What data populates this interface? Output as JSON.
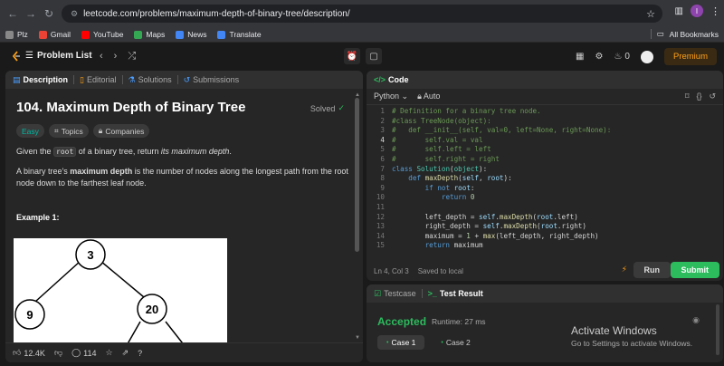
{
  "browser": {
    "url": "leetcode.com/problems/maximum-depth-of-binary-tree/description/",
    "profile_initial": "I",
    "bookmarks": [
      {
        "label": "Plz",
        "color": "#888888"
      },
      {
        "label": "Gmail",
        "color": "#ea4335"
      },
      {
        "label": "YouTube",
        "color": "#ff0000"
      },
      {
        "label": "Maps",
        "color": "#34a853"
      },
      {
        "label": "News",
        "color": "#4285f4"
      },
      {
        "label": "Translate",
        "color": "#4285f4"
      }
    ],
    "all_bookmarks": "All Bookmarks"
  },
  "lc": {
    "problem_list": "Problem List",
    "streak": "0",
    "premium": "Premium"
  },
  "left_tabs": [
    "Description",
    "Editorial",
    "Solutions",
    "Submissions"
  ],
  "problem": {
    "title": "104. Maximum Depth of Binary Tree",
    "solved": "Solved",
    "difficulty": "Easy",
    "topics": "Topics",
    "companies": "Companies",
    "p1_a": "Given the ",
    "p1_code": "root",
    "p1_b": " of a binary tree, return ",
    "p1_em": "its maximum depth",
    "p1_c": ".",
    "p2_a": "A binary tree's ",
    "p2_b": "maximum depth",
    "p2_c": " is the number of nodes along the longest path from the root node down to the farthest leaf node.",
    "example": "Example 1:",
    "tree_nodes": [
      "3",
      "9",
      "20"
    ]
  },
  "bottom_bar": {
    "likes": "12.4K",
    "comments": "114"
  },
  "code_panel": {
    "tab": "Code",
    "language": "Python",
    "mode": "Auto",
    "status_pos": "Ln 4, Col 3",
    "status_saved": "Saved to local",
    "run": "Run",
    "submit": "Submit"
  },
  "code_lines": [
    {
      "n": "1",
      "text": "# Definition for a binary tree node."
    },
    {
      "n": "2",
      "text": "#class TreeNode(object):"
    },
    {
      "n": "3",
      "text": "#   def __init__(self, val=0, left=None, right=None):"
    },
    {
      "n": "4",
      "text": "#       self.val = val"
    },
    {
      "n": "5",
      "text": "#       self.left = left"
    },
    {
      "n": "6",
      "text": "#       self.right = right"
    },
    {
      "n": "7",
      "text": "class Solution(object):"
    },
    {
      "n": "8",
      "text": "    def maxDepth(self, root):"
    },
    {
      "n": "9",
      "text": "        if not root:"
    },
    {
      "n": "10",
      "text": "            return 0"
    },
    {
      "n": "11",
      "text": ""
    },
    {
      "n": "12",
      "text": "        left_depth = self.maxDepth(root.left)"
    },
    {
      "n": "13",
      "text": "        right_depth = self.maxDepth(root.right)"
    },
    {
      "n": "14",
      "text": "        maximum = 1 + max(left_depth, right_depth)"
    },
    {
      "n": "15",
      "text": "        return maximum"
    }
  ],
  "result": {
    "tab_testcase": "Testcase",
    "tab_result": "Test Result",
    "accepted": "Accepted",
    "runtime": "Runtime: 27 ms",
    "cases": [
      "Case 1",
      "Case 2"
    ]
  },
  "watermark": {
    "title": "Activate Windows",
    "subtitle": "Go to Settings to activate Windows."
  }
}
